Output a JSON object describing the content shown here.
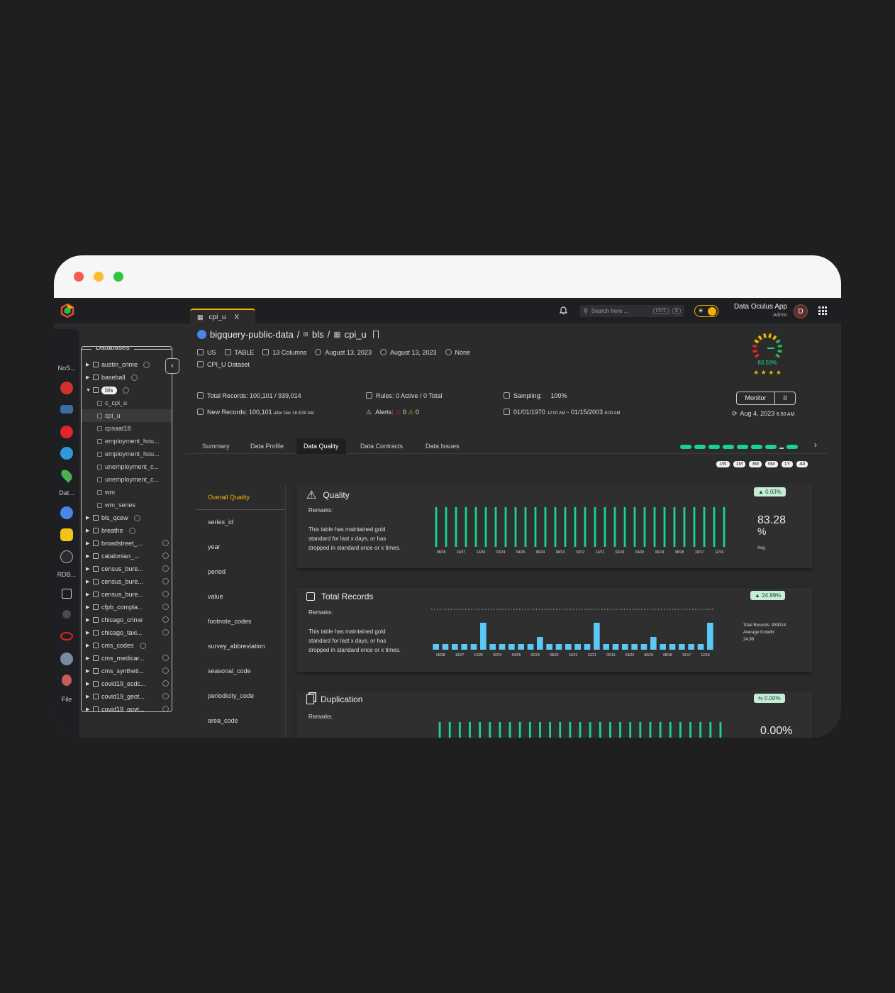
{
  "window": {
    "tab_label": "cpi_u",
    "tab_close": "X"
  },
  "topbar": {
    "search_placeholder": "Search here ...",
    "kbd_ctrl": "Ctrl",
    "kbd_k": "K",
    "app_name": "Data Oculus App",
    "role": "Admin",
    "avatar_letter": "D"
  },
  "rail": {
    "labels": [
      "NoS...",
      "Dat...",
      "RDB...",
      "File"
    ]
  },
  "databases": {
    "title": "Databases",
    "items": [
      {
        "label": "austin_crime",
        "caret": "▶",
        "info": true
      },
      {
        "label": "baseball",
        "caret": "▶",
        "info": true
      },
      {
        "label": "bls",
        "caret": "▼",
        "info": true,
        "chip": true
      },
      {
        "label": "c_cpi_u",
        "child": true
      },
      {
        "label": "cpi_u",
        "child": true,
        "selected": true
      },
      {
        "label": "cpsaat18",
        "child": true
      },
      {
        "label": "employment_hou...",
        "child": true
      },
      {
        "label": "employment_hou...",
        "child": true
      },
      {
        "label": "unemployment_c...",
        "child": true
      },
      {
        "label": "unemployment_c...",
        "child": true
      },
      {
        "label": "wm",
        "child": true
      },
      {
        "label": "wm_series",
        "child": true
      },
      {
        "label": "bls_qcew",
        "caret": "▶",
        "info": true
      },
      {
        "label": "breathe",
        "caret": "▶",
        "info": true
      },
      {
        "label": "broadstreet_...",
        "caret": "▶",
        "info": true
      },
      {
        "label": "catalonian_...",
        "caret": "▶",
        "info": true
      },
      {
        "label": "census_bure...",
        "caret": "▶",
        "info": true
      },
      {
        "label": "census_bure...",
        "caret": "▶",
        "info": true
      },
      {
        "label": "census_bure...",
        "caret": "▶",
        "info": true
      },
      {
        "label": "cfpb_compla...",
        "caret": "▶",
        "info": true
      },
      {
        "label": "chicago_crime",
        "caret": "▶",
        "info": true
      },
      {
        "label": "chicago_taxi...",
        "caret": "▶",
        "info": true
      },
      {
        "label": "cms_codes",
        "caret": "▶",
        "info": true
      },
      {
        "label": "cms_medicar...",
        "caret": "▶",
        "info": true
      },
      {
        "label": "cms_syntheti...",
        "caret": "▶",
        "info": true
      },
      {
        "label": "covid19_ecdc...",
        "caret": "▶",
        "info": true
      },
      {
        "label": "covid19_geot...",
        "caret": "▶",
        "info": true
      },
      {
        "label": "covid19_govt...",
        "caret": "▶",
        "info": true
      }
    ]
  },
  "header": {
    "project": "bigquery-public-data",
    "sep": "/",
    "dataset": "bls",
    "table": "cpi_u",
    "region": "US",
    "type": "TABLE",
    "columns": "13 Columns",
    "created": "August 13, 2023",
    "modified": "August 13, 2023",
    "owner": "None",
    "description": "CPI_U Dataset",
    "quality_score": "83.59%"
  },
  "stats": {
    "total_records_label": "Total Records:",
    "total_records": "100,101 / 939,014",
    "new_records_label": "New Records:",
    "new_records": "100,101",
    "new_records_note": "after Dec 18 8:00 AM",
    "rules_label": "Rules:",
    "rules": "0 Active / 0 Total",
    "alerts_label": "Alerts:",
    "alerts_red": "0",
    "alerts_yellow": "0",
    "sampling_label": "Sampling:",
    "sampling": "100%",
    "range_start": "01/01/1970",
    "range_start_time": "12:00 AM",
    "range_dash": "-",
    "range_end": "01/15/2003",
    "range_end_time": "8:00 AM",
    "monitor": "Monitor",
    "pause": "II",
    "refreshed": "Aug 4, 2023",
    "refreshed_time": "6:50 AM"
  },
  "tabs": [
    "Summary",
    "Data Profile",
    "Data Quality",
    "Data Contracts",
    "Data Issues"
  ],
  "time_ranges": [
    "1W",
    "1M",
    "3M",
    "6M",
    "1Y",
    "All"
  ],
  "columns": [
    "Overall Quality",
    "series_id",
    "year",
    "period",
    "value",
    "footnote_codes",
    "survey_abbreviation",
    "seasonal_code",
    "periodicity_code",
    "area_code"
  ],
  "cards": {
    "quality": {
      "title": "Quality",
      "badge": "▲ 0.03%",
      "remarks_label": "Remarks:",
      "remarks": "This table has maintained gold standard for last x days, or has dropped in standard once or x times.",
      "value": "83.28",
      "unit": "%",
      "sub": "Avg."
    },
    "records": {
      "title": "Total Records",
      "badge": "▲ 24.99%",
      "remarks_label": "Remarks:",
      "remarks": "This table has maintained gold standard for last x days, or has dropped in standard once or x times.",
      "note_total": "Total Records: 939014",
      "note_growth_label": "Average Growth:",
      "note_growth": "24.99"
    },
    "duplication": {
      "title": "Duplication",
      "badge": "⇆ 0.00%",
      "remarks_label": "Remarks:",
      "value": "0.00%"
    }
  },
  "chart_data": [
    {
      "type": "bar",
      "title": "Quality",
      "x_ticks": [
        "08/28",
        "10/27",
        "12/26",
        "02/24",
        "04/25",
        "06/24",
        "08/23",
        "10/22",
        "12/21",
        "02/19",
        "04/20",
        "06/19",
        "08/18",
        "10/17",
        "12/16"
      ],
      "values": [
        1,
        1,
        1,
        1,
        1,
        1,
        1,
        1,
        1,
        1,
        1,
        1,
        1,
        1,
        1,
        1,
        1,
        1,
        1,
        1,
        1,
        1,
        1,
        1,
        1,
        1,
        1,
        1,
        1,
        1
      ],
      "color": "#19d48d"
    },
    {
      "type": "bar",
      "title": "Total Records",
      "x_ticks": [
        "06/28",
        "10/27",
        "12/26",
        "02/24",
        "04/25",
        "06/24",
        "08/23",
        "10/22",
        "12/21",
        "02/19",
        "04/20",
        "06/19",
        "08/18",
        "10/17",
        "12/16"
      ],
      "values": [
        1,
        1,
        1,
        1,
        1,
        4,
        1,
        1,
        1,
        1,
        1,
        2,
        1,
        1,
        1,
        1,
        1,
        4,
        1,
        1,
        1,
        1,
        1,
        2,
        1,
        1,
        1,
        1,
        1,
        4
      ],
      "color": "#5bc8f5"
    },
    {
      "type": "bar",
      "title": "Duplication",
      "x_ticks": [],
      "values": [
        1,
        1,
        1,
        1,
        1,
        1,
        1,
        1,
        1,
        1,
        1,
        1,
        1,
        1,
        1,
        1,
        1,
        1,
        1,
        1,
        1,
        1,
        1,
        1,
        1,
        1,
        1,
        1,
        1
      ],
      "color": "#19d48d"
    }
  ]
}
